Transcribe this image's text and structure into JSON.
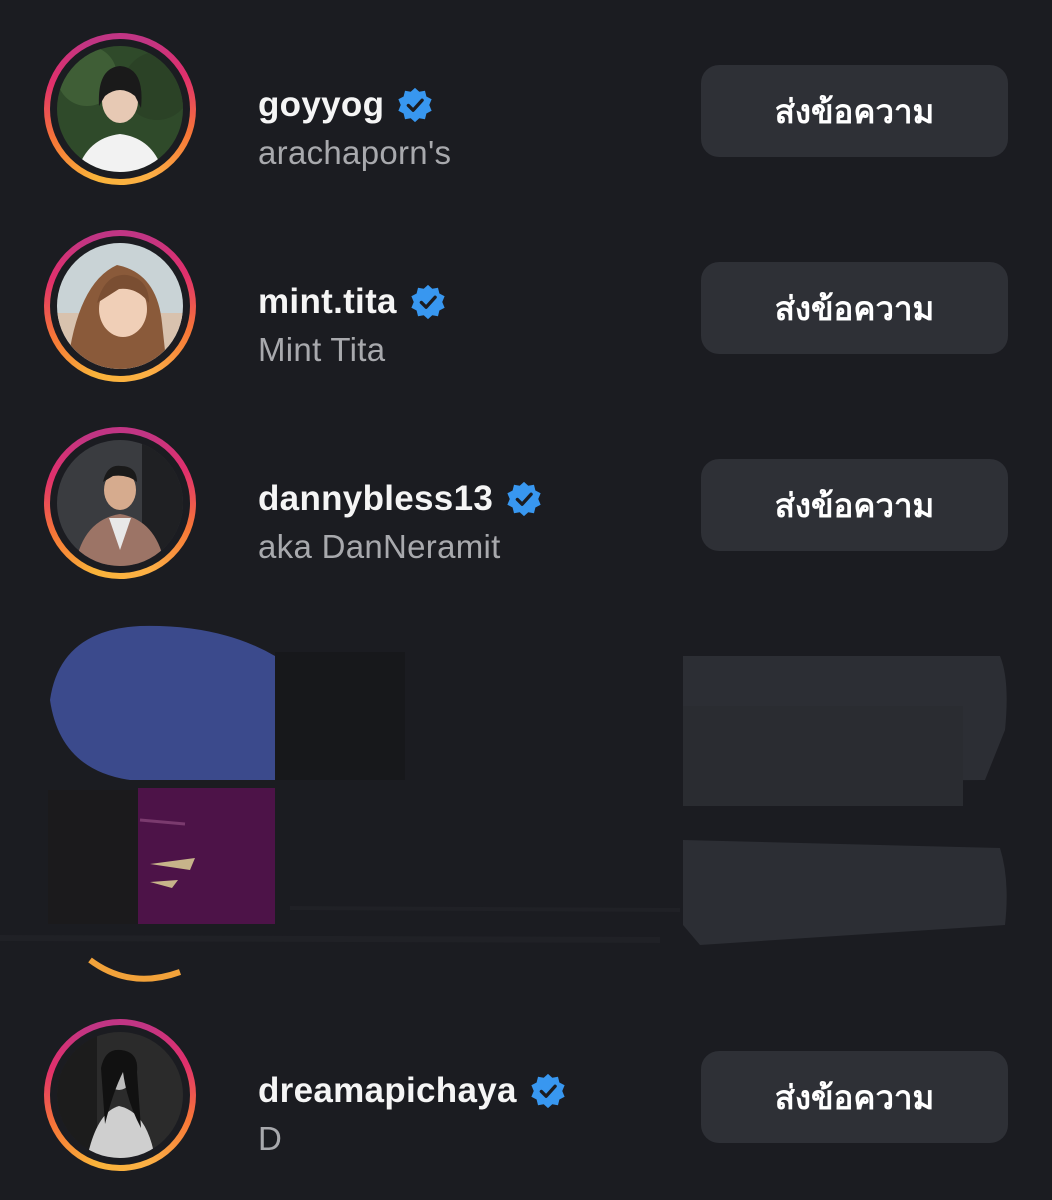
{
  "message_label": "ส่งข้อความ",
  "accounts": [
    {
      "username": "goyyog",
      "fullname": "arachaporn's",
      "verified": true
    },
    {
      "username": "mint.tita",
      "fullname": "Mint Tita",
      "verified": true
    },
    {
      "username": "dannybless13",
      "fullname": "aka DanNeramit",
      "verified": true
    },
    {
      "username": "dreamapichaya",
      "fullname": "D",
      "verified": true
    }
  ],
  "colors": {
    "background": "#1b1c21",
    "button": "#2e3036",
    "verified": "#3897f0",
    "redact_blue": "#3b4a8c",
    "redact_purple": "#4d1348"
  }
}
